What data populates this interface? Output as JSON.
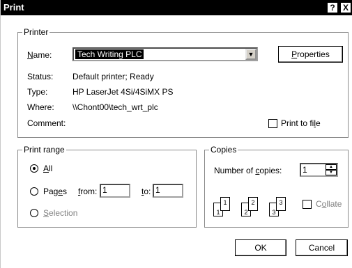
{
  "window": {
    "title": "Print",
    "help_btn": "?",
    "close_btn": "X"
  },
  "printer": {
    "legend": "Printer",
    "name_label": "Name:",
    "name_value": "Tech Writing PLC",
    "properties_btn": "Properties",
    "status_label": "Status:",
    "status_value": "Default printer; Ready",
    "type_label": "Type:",
    "type_value": "HP LaserJet 4Si/4SiMX PS",
    "where_label": "Where:",
    "where_value": "\\\\Chont00\\tech_wrt_plc",
    "comment_label": "Comment:",
    "comment_value": "",
    "print_to_file_label": "Print to file",
    "print_to_file_checked": false
  },
  "print_range": {
    "legend": "Print range",
    "all_label": "All",
    "pages_label": "Pages",
    "from_label": "from:",
    "from_value": "1",
    "to_label": "to:",
    "to_value": "1",
    "selection_label": "Selection",
    "selected": "all"
  },
  "copies": {
    "legend": "Copies",
    "number_label": "Number of copies:",
    "number_value": "1",
    "collate_label": "Collate",
    "collate_checked": false,
    "collate_icon_numbers": [
      "1",
      "1",
      "2",
      "2",
      "3",
      "3"
    ]
  },
  "footer": {
    "ok_btn": "OK",
    "cancel_btn": "Cancel"
  }
}
